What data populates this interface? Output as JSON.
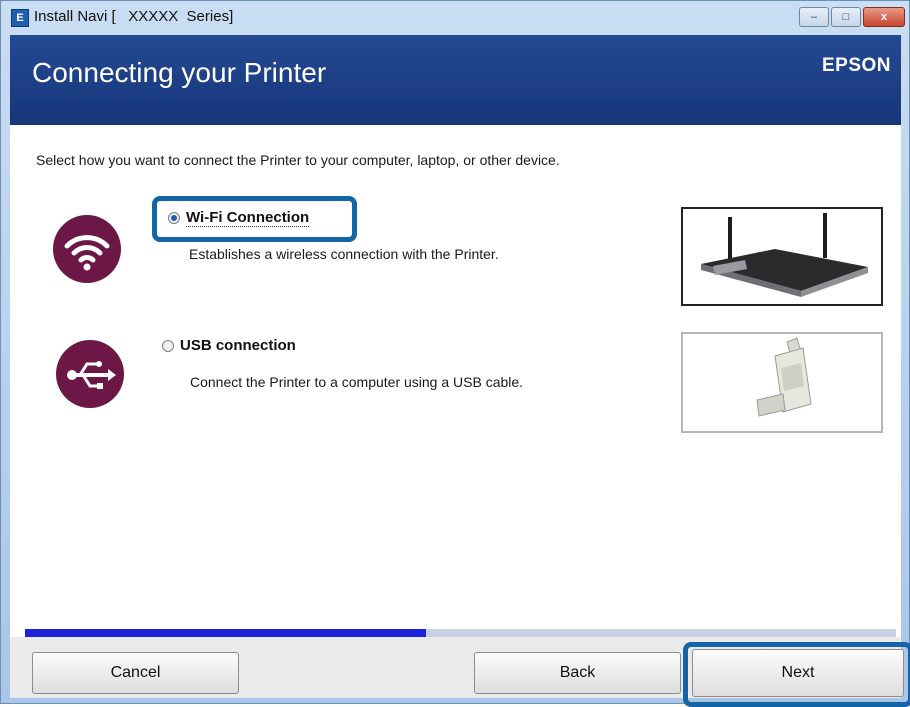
{
  "window": {
    "title": "Install Navi [   XXXXX  Series]",
    "app_icon_glyph": "E",
    "controls": {
      "minimize": "–",
      "maximize": "□",
      "close": "x"
    }
  },
  "header": {
    "title": "Connecting your Printer",
    "brand": "EPSON",
    "colors": {
      "top": "#244a93",
      "bottom": "#17357a"
    }
  },
  "instruction": "Select how you want to connect the Printer to your computer, laptop, or other device.",
  "options": [
    {
      "label": "Wi-Fi Connection",
      "description": "Establishes a wireless connection with the Printer.",
      "selected": true,
      "icon": "wifi-icon",
      "image": "router-image"
    },
    {
      "label": "USB connection",
      "description": "Connect the Printer to a computer using a USB cable.",
      "selected": false,
      "icon": "usb-icon",
      "image": "usb-cable-image"
    }
  ],
  "progress": {
    "fraction": 0.46,
    "fill_color": "#1c22d8",
    "track_color": "#c7d1e3"
  },
  "footer": {
    "cancel_label": "Cancel",
    "back_label": "Back",
    "next_label": "Next"
  },
  "accent_color": "#1464a8",
  "icon_circle_color": "#6c1746"
}
